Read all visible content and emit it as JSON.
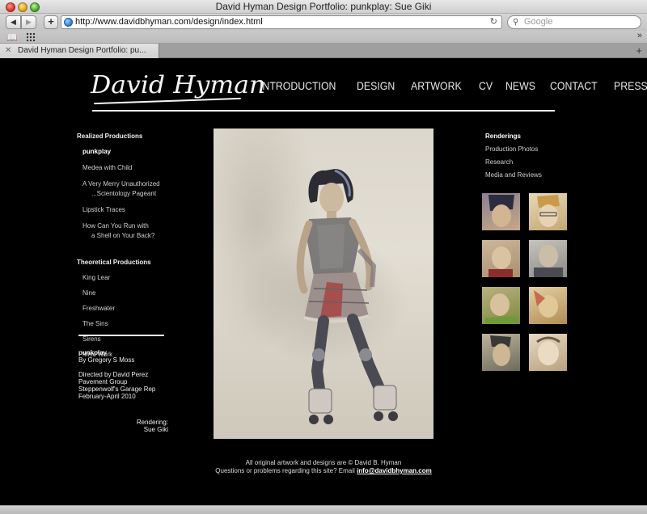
{
  "browser": {
    "window_title": "David Hyman Design Portfolio: punkplay: Sue Giki",
    "url": "http://www.davidbhyman.com/design/index.html",
    "search_placeholder": "Google",
    "tab_title": "David Hyman Design Portfolio: pu..."
  },
  "site": {
    "nav": [
      "INTRODUCTION",
      "DESIGN",
      "ARTWORK",
      "CV",
      "NEWS",
      "CONTACT",
      "PRESS"
    ]
  },
  "left_nav": {
    "realized_heading": "Realized Productions",
    "realized": [
      {
        "line1": "punkplay",
        "line2": ""
      },
      {
        "line1": "Medea with Child",
        "line2": ""
      },
      {
        "line1": "A Very Merry Unauthorized",
        "line2": "...Scientology Pageant"
      },
      {
        "line1": "Lipstick Traces",
        "line2": ""
      },
      {
        "line1": "How Can You Run with",
        "line2": "a Shell on Your Back?"
      }
    ],
    "theoretical_heading": "Theoretical Productions",
    "theoretical": [
      "King Lear",
      "Nine",
      "Freshwater",
      "The Sins",
      "Sirens",
      "Misc Work"
    ]
  },
  "info": {
    "title": "punkplay",
    "author": "By Gregory S Moss",
    "directed": "Directed by David Perez",
    "group": "Pavement Group",
    "venue": "Steppenwolf's Garage Rep",
    "dates": "February-April 2010",
    "credit_label": "Rendering:",
    "credit_name": "Sue Giki"
  },
  "right_nav": [
    "Renderings",
    "Production Photos",
    "Research",
    "Media and Reviews"
  ],
  "footer": {
    "line1": "All original artwork and designs are © David B. Hyman",
    "line2": "Questions or problems regarding this site? Email",
    "email": "info@davidbhyman.com"
  }
}
